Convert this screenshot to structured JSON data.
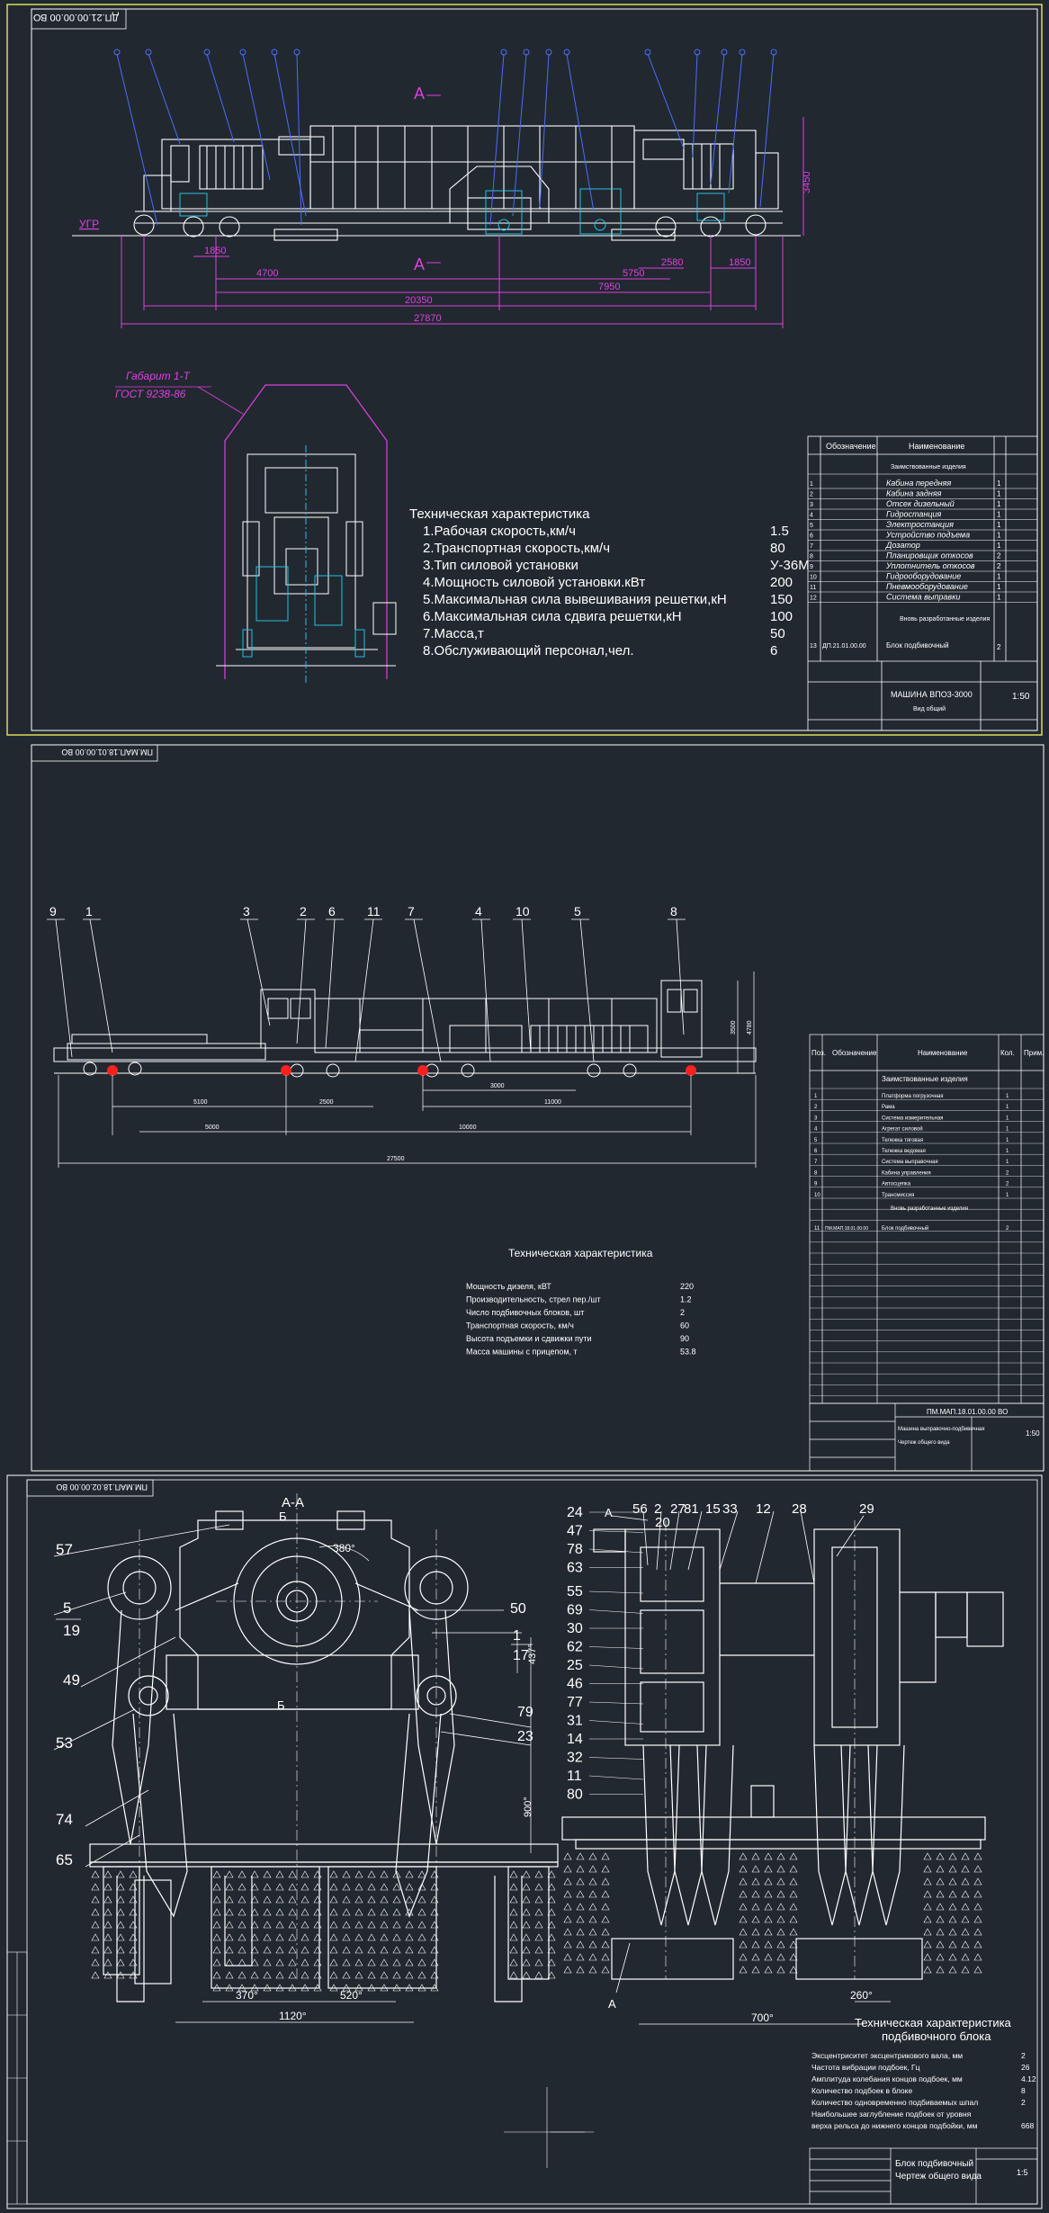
{
  "sheet1": {
    "stamp": "ДП.21.00.00.00 ВО",
    "section_mark": "А",
    "rail_label": "УГР",
    "dims": {
      "d1850a": "1850",
      "d4700": "4700",
      "d5750": "5750",
      "d2580": "2580",
      "d1850b": "1850",
      "d7950": "7950",
      "d20350": "20350",
      "d27870": "27870",
      "h3450": "3450"
    },
    "gabarit_1": "Габарит 1-Т",
    "gabarit_2": "ГОСТ 9238-86",
    "specs_title": "Техническая характеристика",
    "specs": [
      {
        "label": "1.Рабочая скорость,км/ч",
        "value": "1.5"
      },
      {
        "label": "2.Транспортная скорость,км/ч",
        "value": "80"
      },
      {
        "label": "3.Тип силовой установки",
        "value": "У-36М"
      },
      {
        "label": "4.Мощность силовой установки.кВт",
        "value": "200"
      },
      {
        "label": "5.Максимальная сила вывешивания решетки,кН",
        "value": "150"
      },
      {
        "label": "6.Максимальная сила сдвига решетки,кН",
        "value": "100"
      },
      {
        "label": "7.Масса,т",
        "value": "50"
      },
      {
        "label": "8.Обслуживающий персонал,чел.",
        "value": "6"
      }
    ],
    "table_headers": [
      "Обозначение",
      "Наименование"
    ],
    "table_section": "Заимствованные изделия",
    "table_rows": [
      {
        "n": "1",
        "name": "Кабина передняя",
        "q": "1"
      },
      {
        "n": "2",
        "name": "Кабина задняя",
        "q": "1"
      },
      {
        "n": "3",
        "name": "Отсек дизельный",
        "q": "1"
      },
      {
        "n": "4",
        "name": "Гидростанция",
        "q": "1"
      },
      {
        "n": "5",
        "name": "Электростанция",
        "q": "1"
      },
      {
        "n": "6",
        "name": "Устройство подъема",
        "q": "1"
      },
      {
        "n": "7",
        "name": "Дозатор",
        "q": "1"
      },
      {
        "n": "8",
        "name": "Планировщик откосов",
        "q": "2"
      },
      {
        "n": "9",
        "name": "Уплотнитель откосов",
        "q": "2"
      },
      {
        "n": "10",
        "name": "Гидрооборудование",
        "q": "1"
      },
      {
        "n": "11",
        "name": "Пневмооборудование",
        "q": "1"
      },
      {
        "n": "12",
        "name": "Система выправки",
        "q": "1"
      }
    ],
    "table_section2": "Вновь разработанные изделия",
    "table_last": {
      "n": "13",
      "code": "ДП.21.01.00.00",
      "name": "Блок подбивочный",
      "q": "2"
    },
    "title_block": {
      "name": "МАШИНА ВПО3-3000",
      "sub": "Вид общий",
      "scale": "1:50"
    }
  },
  "sheet2": {
    "stamp": "ПМ.МАП.18.01.00.00 ВО",
    "callouts": [
      "9",
      "1",
      "3",
      "2",
      "6",
      "11",
      "7",
      "4",
      "10",
      "5",
      "8"
    ],
    "dims": {
      "d5100": "5100",
      "d2500": "2500",
      "d3000": "3000",
      "d11000": "11000",
      "d5000": "5000",
      "d10000": "10000",
      "d27500": "27500",
      "h3500": "3500",
      "h4780": "4780"
    },
    "specs_title": "Техническая характеристика",
    "specs": [
      {
        "label": "Мощность дизеля, кВТ",
        "value": "220"
      },
      {
        "label": "Производительность, стрел пер./шт",
        "value": "1.2"
      },
      {
        "label": "Число подбивочных блоков, шт",
        "value": "2"
      },
      {
        "label": "Транспортная скорость, км/ч",
        "value": "60"
      },
      {
        "label": "Высота подъемки и сдвижки пути",
        "value": "90"
      },
      {
        "label": "Масса машины с прицепом, т",
        "value": "53.8"
      }
    ],
    "table_headers": [
      "Поз.",
      "Обозначение",
      "Наименование",
      "Кол.",
      "Прим."
    ],
    "table_section": "Заимствованные изделия",
    "table_rows": [
      {
        "n": "1",
        "name": "Платформа погрузочная",
        "q": "1"
      },
      {
        "n": "2",
        "name": "Рама",
        "q": "1"
      },
      {
        "n": "3",
        "name": "Система измерительная",
        "q": "1"
      },
      {
        "n": "4",
        "name": "Агрегат силовой",
        "q": "1"
      },
      {
        "n": "5",
        "name": "Тележка тяговая",
        "q": "1"
      },
      {
        "n": "6",
        "name": "Тележка ведомая",
        "q": "1"
      },
      {
        "n": "7",
        "name": "Система выправочная",
        "q": "1"
      },
      {
        "n": "8",
        "name": "Кабина управления",
        "q": "2"
      },
      {
        "n": "9",
        "name": "Автосцепка",
        "q": "2"
      },
      {
        "n": "10",
        "name": "Трансмиссия",
        "q": "1"
      }
    ],
    "table_section2": "Вновь разработанные изделия",
    "table_last": {
      "n": "11",
      "code": "ПМ.МАП.18.01.00.00",
      "name": "Блок подбивочный",
      "q": "2"
    },
    "title_block": {
      "code": "ПМ.МАП.18.01.00.00 ВО",
      "name": "Машина выправочно-подбивочная",
      "sub": "Чертеж общего вида",
      "scale": "1:50"
    }
  },
  "sheet3": {
    "stamp": "ПМ.МАП.18.02.00.00 ВО",
    "section_title": "А-А",
    "b_mark": "Б",
    "left_callouts": [
      "57",
      "5",
      "19",
      "49",
      "53",
      "74",
      "65"
    ],
    "right_callouts_left": [
      "50",
      "1",
      "17",
      "79",
      "23"
    ],
    "mid_left_callouts": [
      "24",
      "47",
      "78",
      "63",
      "55",
      "69",
      "30",
      "62",
      "25",
      "46",
      "77",
      "31",
      "14",
      "32",
      "11",
      "80"
    ],
    "top_callouts": [
      "56",
      "2",
      "27",
      "81",
      "15",
      "33",
      "12",
      "28"
    ],
    "top_callouts2": [
      "20",
      "29"
    ],
    "a_mark": "А",
    "dims": {
      "d380": "380°",
      "d437": "437°",
      "d900": "900°",
      "d370": "370°",
      "d520": "520°",
      "d1120": "1120°",
      "d700": "700°",
      "d260": "260°"
    },
    "specs_title": "Техническая характеристика",
    "specs_title2": "подбивочного блока",
    "specs": [
      {
        "label": "Эксцентриситет эксцентрикового вала, мм",
        "value": "2"
      },
      {
        "label": "Частота вибрации подбоек, Гц",
        "value": "26"
      },
      {
        "label": "Амплитуда колебания концов подбоек, мм",
        "value": "4.12"
      },
      {
        "label": "Количество подбоек в блоке",
        "value": "8"
      },
      {
        "label": "Количество одновременно подбиваемых шпал",
        "value": "2"
      },
      {
        "label": "Наибольшее заглубление подбоек от уровня",
        "value": ""
      },
      {
        "label": "верха рельса до нижнего концов подбойки, мм",
        "value": "668"
      }
    ],
    "title_block": {
      "name": "Блок подбивочный",
      "sub": "Чертеж общего вида",
      "scale": "1:5"
    }
  }
}
